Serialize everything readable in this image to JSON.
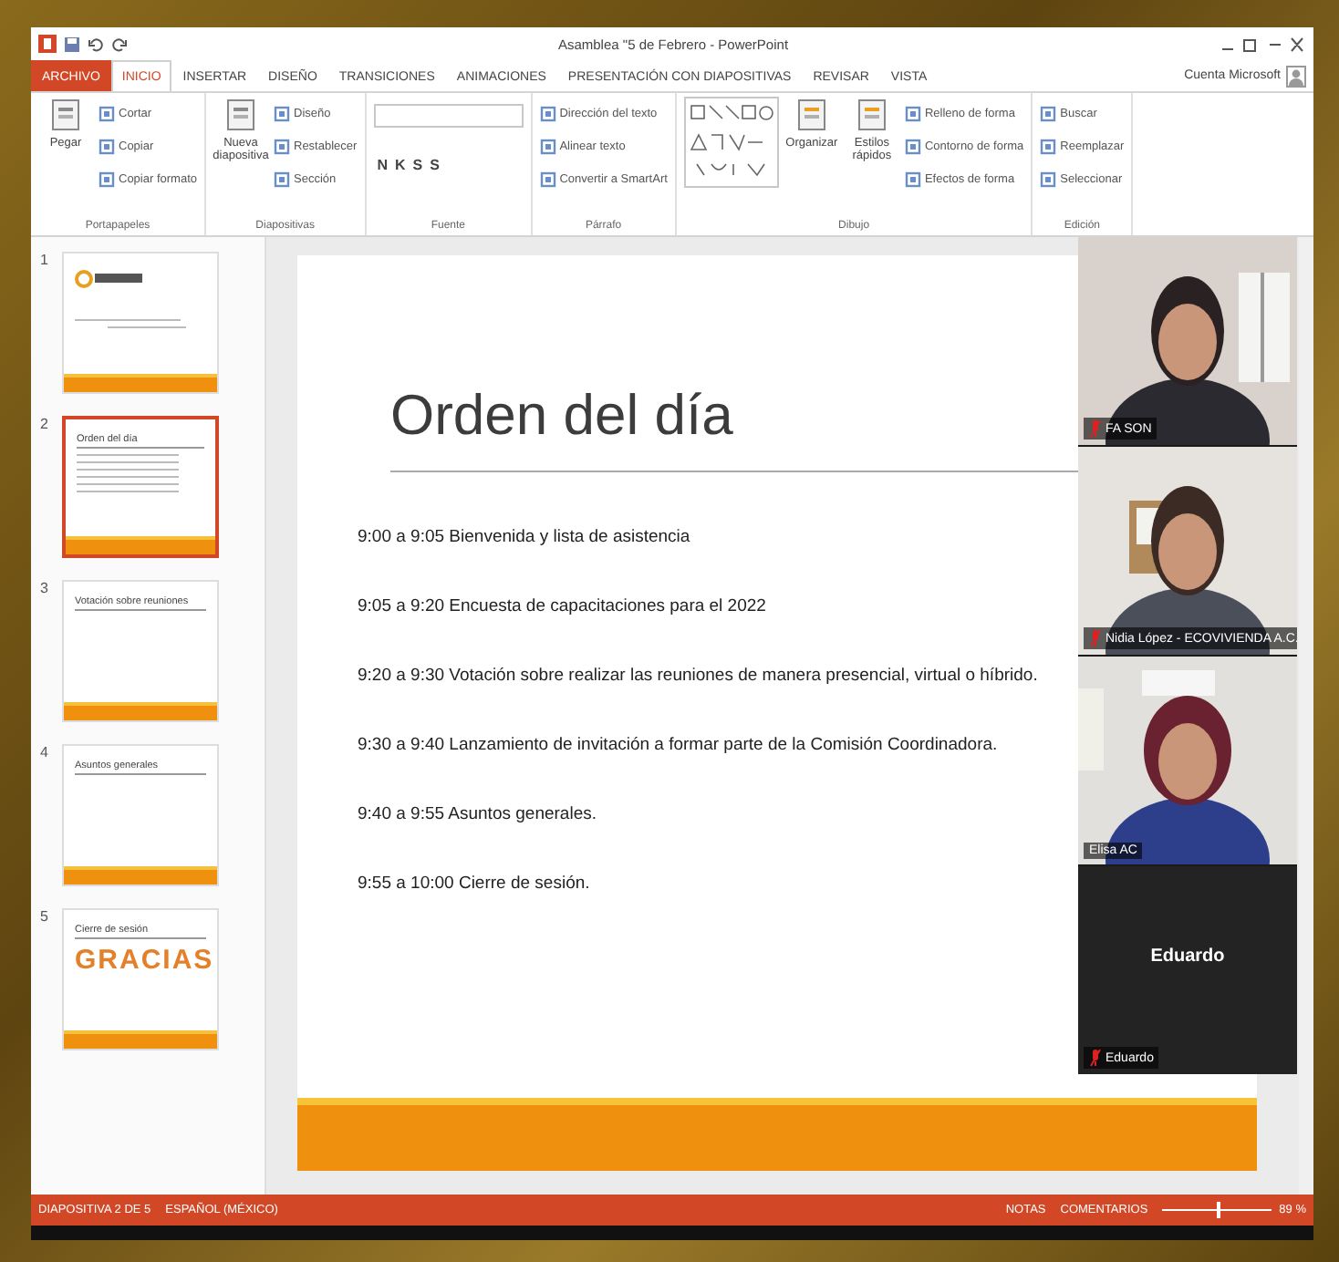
{
  "window": {
    "title": "Asamblea \"5 de Febrero - PowerPoint"
  },
  "ribbon_tabs": [
    {
      "label": "ARCHIVO",
      "kind": "file",
      "selected": false
    },
    {
      "label": "INICIO",
      "kind": "tab",
      "selected": true
    },
    {
      "label": "INSERTAR",
      "kind": "tab",
      "selected": false
    },
    {
      "label": "DISEÑO",
      "kind": "tab",
      "selected": false
    },
    {
      "label": "TRANSICIONES",
      "kind": "tab",
      "selected": false
    },
    {
      "label": "ANIMACIONES",
      "kind": "tab",
      "selected": false
    },
    {
      "label": "PRESENTACIÓN CON DIAPOSITIVAS",
      "kind": "tab",
      "selected": false
    },
    {
      "label": "REVISAR",
      "kind": "tab",
      "selected": false
    },
    {
      "label": "VISTA",
      "kind": "tab",
      "selected": false
    }
  ],
  "account": "Cuenta Microsoft",
  "ribbon_groups": [
    {
      "label": "Portapapeles",
      "items": [
        {
          "label": "Pegar",
          "kind": "large"
        },
        {
          "label": "Cortar",
          "kind": "small"
        },
        {
          "label": "Copiar",
          "kind": "small"
        },
        {
          "label": "Copiar formato",
          "kind": "small"
        }
      ]
    },
    {
      "label": "Diapositivas",
      "items": [
        {
          "label": "Nueva diapositiva",
          "kind": "large"
        },
        {
          "label": "Diseño",
          "kind": "small"
        },
        {
          "label": "Restablecer",
          "kind": "small"
        },
        {
          "label": "Sección",
          "kind": "small"
        }
      ]
    },
    {
      "label": "Fuente",
      "items": [
        {
          "label": "N",
          "kind": "glyph"
        },
        {
          "label": "K",
          "kind": "glyph"
        },
        {
          "label": "S",
          "kind": "glyph"
        },
        {
          "label": "S",
          "kind": "glyph"
        }
      ]
    },
    {
      "label": "Párrafo",
      "items": [
        {
          "label": "Dirección del texto",
          "kind": "small"
        },
        {
          "label": "Alinear texto",
          "kind": "small"
        },
        {
          "label": "Convertir a SmartArt",
          "kind": "small"
        }
      ]
    },
    {
      "label": "Dibujo",
      "items": [
        {
          "kind": "shapes"
        },
        {
          "label": "Organizar",
          "kind": "large"
        },
        {
          "label": "Estilos rápidos",
          "kind": "large"
        },
        {
          "label": "Relleno de forma",
          "kind": "small"
        },
        {
          "label": "Contorno de forma",
          "kind": "small"
        },
        {
          "label": "Efectos de forma",
          "kind": "small"
        }
      ]
    },
    {
      "label": "Edición",
      "items": [
        {
          "label": "Buscar",
          "kind": "small"
        },
        {
          "label": "Reemplazar",
          "kind": "small"
        },
        {
          "label": "Seleccionar",
          "kind": "small"
        }
      ]
    }
  ],
  "thumbnails": [
    {
      "number": "1",
      "kind": "cover",
      "selected": false
    },
    {
      "number": "2",
      "kind": "agenda",
      "title": "Orden del día",
      "selected": true
    },
    {
      "number": "3",
      "kind": "title",
      "title": "Votación sobre reuniones",
      "selected": false
    },
    {
      "number": "4",
      "kind": "title",
      "title": "Asuntos generales",
      "selected": false
    },
    {
      "number": "5",
      "kind": "thanks",
      "title": "Cierre de sesión",
      "banner": "GRACIAS",
      "selected": false
    }
  ],
  "slide": {
    "title": "Orden del día",
    "items": [
      "9:00 a 9:05 Bienvenida y lista de asistencia",
      "9:05 a 9:20 Encuesta de capacitaciones para el 2022",
      "9:20 a 9:30 Votación sobre realizar las reuniones de manera presencial, virtual o híbrido.",
      "9:30 a 9:40 Lanzamiento de invitación a formar parte de la Comisión Coordinadora.",
      "9:40 a 9:55 Asuntos generales.",
      "9:55 a 10:00 Cierre de sesión."
    ]
  },
  "participants": [
    {
      "name": "FA SON",
      "kind": "picture",
      "muted": true
    },
    {
      "name": "Nidia López - ECOVIVIENDA A.C.",
      "kind": "picture",
      "muted": true
    },
    {
      "name": "Elisa AC",
      "kind": "picture",
      "muted": false
    },
    {
      "name": "Eduardo",
      "kind": "avatar",
      "display_name": "Eduardo",
      "muted": true
    }
  ],
  "status_bar": {
    "slide": "DIAPOSITIVA 2 DE 5",
    "language": "ESPAÑOL (MÉXICO)",
    "notes": "NOTAS",
    "comments": "COMENTARIOS",
    "zoom": {
      "level": 0.5,
      "reading": "89 %"
    }
  }
}
